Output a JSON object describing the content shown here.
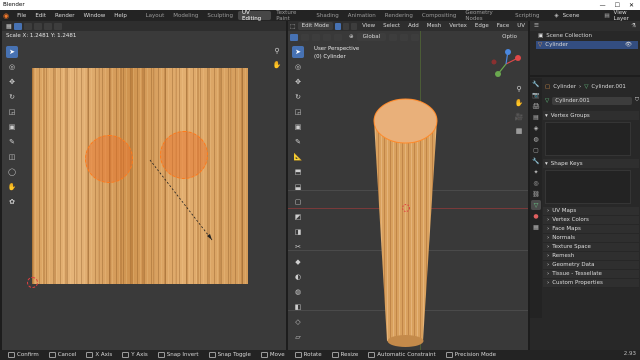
{
  "window": {
    "title": "Blender",
    "controls": [
      "—",
      "☐",
      "✕"
    ]
  },
  "menubar": {
    "items": [
      "File",
      "Edit",
      "Render",
      "Window",
      "Help"
    ],
    "workspaces": [
      "Layout",
      "Modeling",
      "Sculpting",
      "UV Editing",
      "Texture Paint",
      "Shading",
      "Animation",
      "Rendering",
      "Compositing",
      "Geometry Nodes",
      "Scripting"
    ],
    "active_workspace": "UV Editing",
    "scene": "Scene",
    "view_layer": "View Layer"
  },
  "uv_editor": {
    "scale_readout": "Scale X: 1.2481  Y: 1.2481",
    "tools": [
      "select-cursor-icon",
      "cursor-icon",
      "move-icon",
      "rotate-icon",
      "scale-icon",
      "transform-icon",
      "annotate-icon",
      "rip-icon",
      "grab-icon",
      "relax-icon",
      "pinch-icon"
    ],
    "active_tool": "select-cursor-icon"
  },
  "viewport": {
    "mode": "Edit Mode",
    "menus": [
      "View",
      "Select",
      "Add",
      "Mesh",
      "Vertex",
      "Edge",
      "Face",
      "UV"
    ],
    "transform": "Global",
    "options_label": "Optio",
    "view_name": "User Perspective",
    "object_label": "(0) Cylinder"
  },
  "outliner": {
    "rows": [
      {
        "label": "Scene Collection",
        "selected": false
      },
      {
        "label": "Cylinder",
        "selected": true
      }
    ]
  },
  "properties": {
    "object_name": "Cylinder",
    "mesh_name": "Cylinder.001",
    "data_field": "Cylinder.001",
    "panels_open": [
      "Vertex Groups",
      "Shape Keys"
    ],
    "panels_closed": [
      "UV Maps",
      "Vertex Colors",
      "Face Maps",
      "Normals",
      "Texture Space",
      "Remesh",
      "Geometry Data",
      "Tissue - Tessellate",
      "Custom Properties"
    ]
  },
  "statusbar": {
    "items": [
      "Confirm",
      "Cancel",
      "X Axis",
      "Y Axis",
      "Snap Invert",
      "Snap Toggle",
      "Move",
      "Rotate",
      "Resize",
      "Automatic Constraint",
      "Precision Mode"
    ],
    "version": "2.93"
  },
  "colors": {
    "accent": "#4772b3",
    "selection_orange": "#ff7a1a",
    "background": "#393939"
  }
}
